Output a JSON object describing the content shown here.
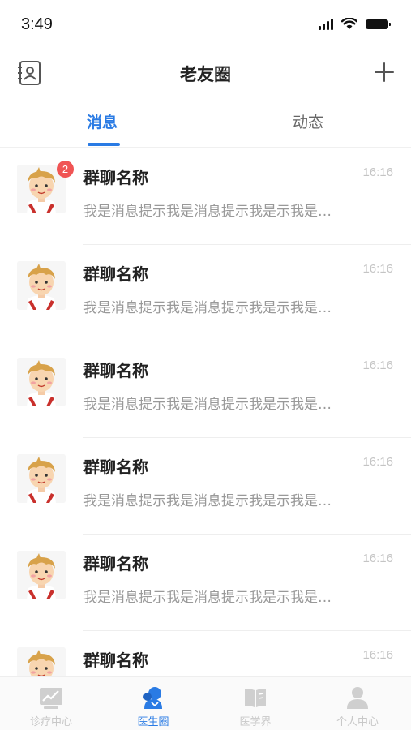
{
  "status_bar": {
    "time": "3:49"
  },
  "nav": {
    "title": "老友圈"
  },
  "tabs": [
    {
      "label": "消息",
      "active": true
    },
    {
      "label": "动态",
      "active": false
    }
  ],
  "conversations": [
    {
      "name": "群聊名称",
      "time": "16:16",
      "message": "我是消息提示我是消息提示我是示我是…",
      "badge": "2"
    },
    {
      "name": "群聊名称",
      "time": "16:16",
      "message": "我是消息提示我是消息提示我是示我是…"
    },
    {
      "name": "群聊名称",
      "time": "16:16",
      "message": "我是消息提示我是消息提示我是示我是…"
    },
    {
      "name": "群聊名称",
      "time": "16:16",
      "message": "我是消息提示我是消息提示我是示我是…"
    },
    {
      "name": "群聊名称",
      "time": "16:16",
      "message": "我是消息提示我是消息提示我是示我是…"
    },
    {
      "name": "群聊名称",
      "time": "16:16",
      "message": ""
    }
  ],
  "tabbar": [
    {
      "label": "诊疗中心",
      "icon": "chart-icon",
      "active": false
    },
    {
      "label": "医生圈",
      "icon": "doctor-circle-icon",
      "active": true
    },
    {
      "label": "医学界",
      "icon": "book-icon",
      "active": false
    },
    {
      "label": "个人中心",
      "icon": "person-icon",
      "active": false
    }
  ],
  "colors": {
    "accent": "#2a7be4",
    "badge": "#f05454",
    "muted": "#999999"
  }
}
